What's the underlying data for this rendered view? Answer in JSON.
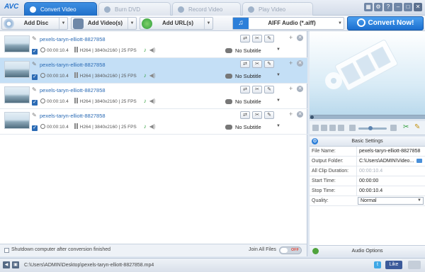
{
  "app": {
    "logo": "AVC"
  },
  "tabs": [
    {
      "label": "Convert Video",
      "active": true
    },
    {
      "label": "Burn DVD",
      "active": false
    },
    {
      "label": "Record Video",
      "active": false
    },
    {
      "label": "Play Video",
      "active": false
    }
  ],
  "toolbar": {
    "add_disc": "Add Disc",
    "add_videos": "Add Video(s)",
    "add_urls": "Add URL(s)",
    "profile": "AIFF Audio (*.aiff)",
    "convert_now": "Convert Now!"
  },
  "files": [
    {
      "name": "pexels-taryn-elliott-8827858",
      "duration": "00:00:10.4",
      "codec": "H264",
      "resolution": "3840x2160",
      "fps": "25 FPS",
      "subtitle": "No Subtitle",
      "selected": false
    },
    {
      "name": "pexels-taryn-elliott-8827858",
      "duration": "00:00:10.4",
      "codec": "H264",
      "resolution": "3840x2160",
      "fps": "25 FPS",
      "subtitle": "No Subtitle",
      "selected": true
    },
    {
      "name": "pexels-taryn-elliott-8827858",
      "duration": "00:00:10.4",
      "codec": "H264",
      "resolution": "3840x2160",
      "fps": "25 FPS",
      "subtitle": "No Subtitle",
      "selected": false
    },
    {
      "name": "pexels-taryn-elliott-8827858",
      "duration": "00:00:10.4",
      "codec": "H264",
      "resolution": "3840x2160",
      "fps": "25 FPS",
      "subtitle": "No Subtitle",
      "selected": false
    }
  ],
  "footer": {
    "shutdown": "Shutdown computer after conversion finished",
    "join_all": "Join All Files",
    "toggle_state": "OFF"
  },
  "settings": {
    "title": "Basic Settings",
    "rows": [
      {
        "label": "File Name:",
        "value": "pexels-taryn-elliott-8827858"
      },
      {
        "label": "Output Folder:",
        "value": "C:\\Users\\ADMIN\\Video..."
      },
      {
        "label": "All Clip Duration:",
        "value": "00:00:10.4"
      },
      {
        "label": "Start Time:",
        "value": "00:00:00"
      },
      {
        "label": "Stop Time:",
        "value": "00:00:10.4"
      },
      {
        "label": "Quality:",
        "value": "Normal"
      }
    ],
    "audio_options": "Audio Options"
  },
  "status": {
    "path": "C:\\Users\\ADMIN\\Desktop\\pexels-taryn-elliott-8827858.mp4",
    "like": "Like"
  },
  "colors": {
    "accent": "#1f6fc9",
    "selected_row": "#c4dff6",
    "link": "#2b6bb5"
  }
}
